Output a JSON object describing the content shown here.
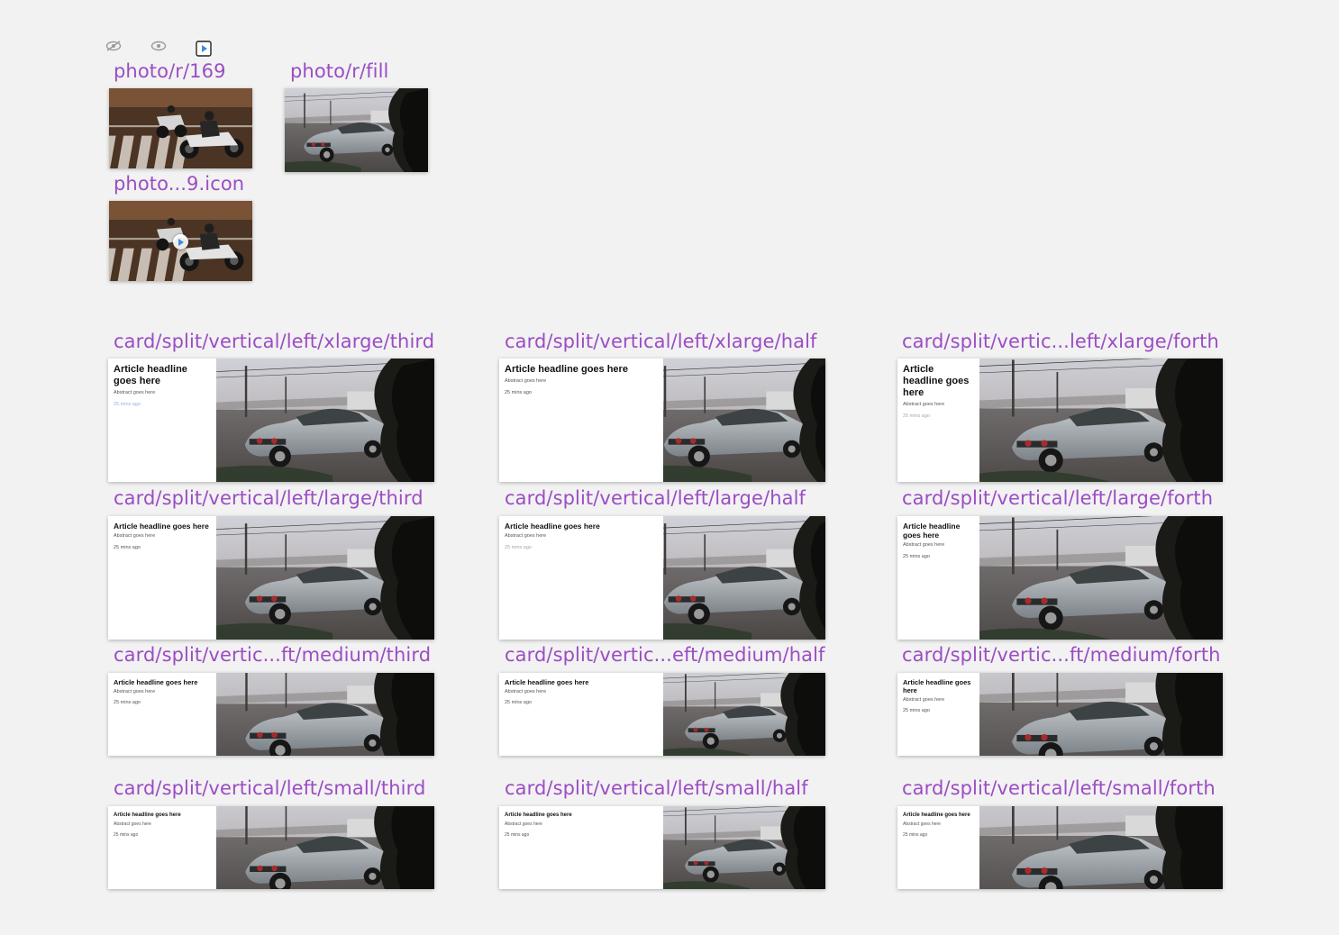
{
  "accent_label_color": "#9b4dc4",
  "toolbar": {
    "icons": [
      "eye-slash-icon",
      "eye-icon",
      "play-icon"
    ]
  },
  "photos": [
    {
      "name": "photo-r-169",
      "label": "photo/r/169",
      "image": "motorcycle-police-photo"
    },
    {
      "name": "photo-r-fill",
      "label": "photo/r/fill",
      "image": "vintage-car-photo"
    },
    {
      "name": "photo-169-icon",
      "label": "photo...9.icon",
      "image": "motorcycle-police-photo",
      "overlay_icon": "play-icon"
    }
  ],
  "card_text": {
    "headline": "Article headline goes here",
    "abstract": "Abstract goes here",
    "time": "25 mins ago"
  },
  "cards": [
    {
      "label": "card/split/vertical/left/xlarge/third"
    },
    {
      "label": "card/split/vertical/left/xlarge/half"
    },
    {
      "label": "card/split/vertic...left/xlarge/forth"
    },
    {
      "label": "card/split/vertical/left/large/third"
    },
    {
      "label": "card/split/vertical/left/large/half"
    },
    {
      "label": "card/split/vertical/left/large/forth"
    },
    {
      "label": "card/split/vertic...ft/medium/third"
    },
    {
      "label": "card/split/vertic...eft/medium/half"
    },
    {
      "label": "card/split/vertic...ft/medium/forth"
    },
    {
      "label": "card/split/vertical/left/small/third"
    },
    {
      "label": "card/split/vertical/left/small/half"
    },
    {
      "label": "card/split/vertical/left/small/forth"
    }
  ]
}
